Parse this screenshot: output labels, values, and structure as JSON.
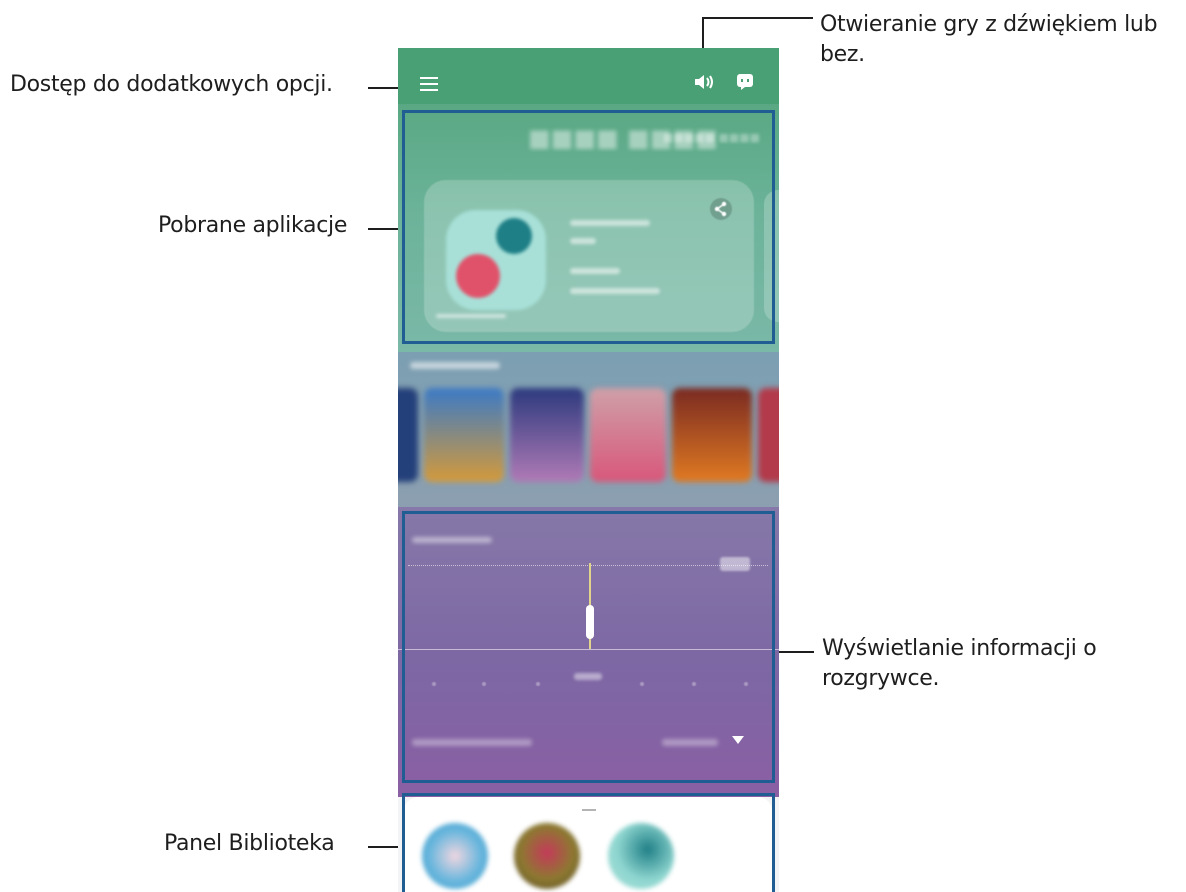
{
  "callouts": {
    "sound": "Otwieranie gry z dźwiękiem lub",
    "sound_line2": "bez.",
    "options": "Dostęp do dodatkowych opcji.",
    "downloaded": "Pobrane aplikacje",
    "info": "Wyświetlanie informacji o",
    "info_line2": "rozgrywce.",
    "library": "Panel Biblioteka"
  },
  "icons": {
    "menu": "hamburger-menu-icon",
    "sound": "speaker-icon",
    "chat": "chat-icon",
    "share": "share-icon",
    "dropdown": "chevron-down-icon"
  },
  "colors": {
    "header": "#4aa075",
    "highlight": "#1f5d93",
    "green_section": "#6cb39a",
    "purple_section": "#7d67a4"
  }
}
